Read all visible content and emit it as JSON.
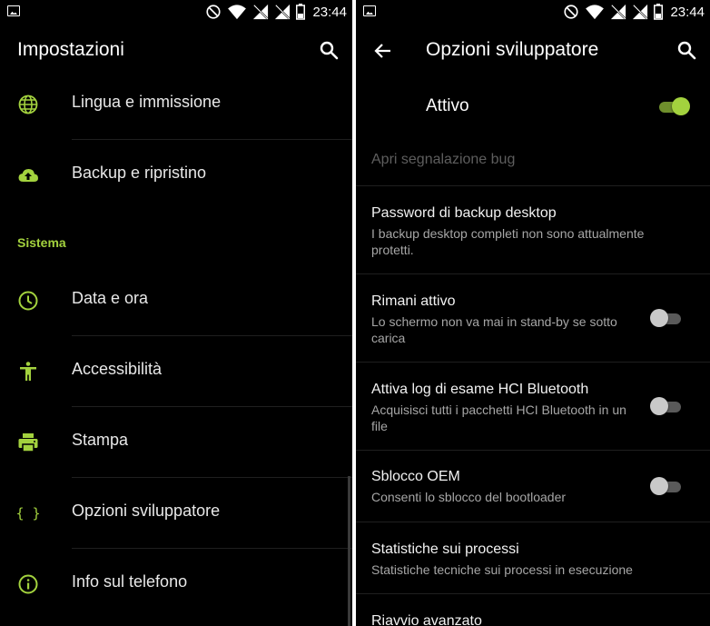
{
  "status_bar": {
    "time": "23:44",
    "icons": [
      "image-icon",
      "do-not-disturb-icon",
      "wifi-icon",
      "no-signal-icon",
      "no-signal-icon",
      "battery-icon"
    ]
  },
  "left_screen": {
    "title": "Impostazioni",
    "items_top": [
      {
        "label": "Lingua e immissione",
        "icon": "globe-icon"
      },
      {
        "label": "Backup e ripristino",
        "icon": "cloud-upload-icon"
      }
    ],
    "section_header": "Sistema",
    "items_system": [
      {
        "label": "Data e ora",
        "icon": "clock-icon"
      },
      {
        "label": "Accessibilità",
        "icon": "accessibility-icon"
      },
      {
        "label": "Stampa",
        "icon": "printer-icon"
      },
      {
        "label": "Opzioni sviluppatore",
        "icon": "braces-icon"
      },
      {
        "label": "Info sul telefono",
        "icon": "info-icon"
      }
    ]
  },
  "right_screen": {
    "title": "Opzioni sviluppatore",
    "master_toggle": {
      "label": "Attivo",
      "on": true
    },
    "items": [
      {
        "title": "Apri segnalazione bug",
        "subtitle": "",
        "disabled": true
      },
      {
        "title": "Password di backup desktop",
        "subtitle": "I backup desktop completi non sono attualmente protetti."
      },
      {
        "title": "Rimani attivo",
        "subtitle": "Lo schermo non va mai in stand-by se sotto carica",
        "toggle_on": false
      },
      {
        "title": "Attiva log di esame HCI Bluetooth",
        "subtitle": "Acquisisci tutti i pacchetti HCI Bluetooth in un file",
        "toggle_on": false
      },
      {
        "title": "Sblocco OEM",
        "subtitle": "Consenti lo sblocco del bootloader",
        "toggle_on": false
      },
      {
        "title": "Statistiche sui processi",
        "subtitle": "Statistiche tecniche sui processi in esecuzione"
      },
      {
        "title": "Riavvio avanzato",
        "subtitle": ""
      }
    ]
  },
  "colors": {
    "accent": "#a3d23e",
    "background": "#000000",
    "divider": "#1f1f1f",
    "secondary_text": "#a6a6a6"
  }
}
